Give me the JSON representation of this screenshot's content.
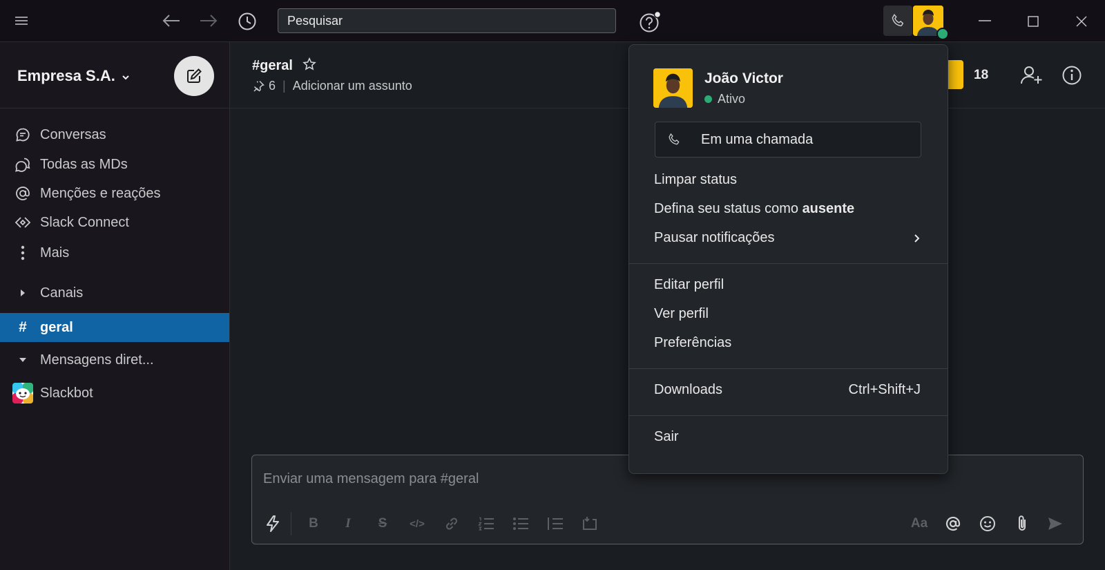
{
  "topbar": {
    "search_placeholder": "Pesquisar"
  },
  "sidebar": {
    "workspace_name": "Empresa S.A.",
    "nav": [
      {
        "label": "Conversas",
        "icon": "threads-icon"
      },
      {
        "label": "Todas as MDs",
        "icon": "dms-icon"
      },
      {
        "label": "Menções e reações",
        "icon": "at-icon"
      },
      {
        "label": "Slack Connect",
        "icon": "slack-connect-icon"
      },
      {
        "label": "Mais",
        "icon": "more-vertical-icon"
      }
    ],
    "channels_section": "Canais",
    "active_channel": "geral",
    "active_channel_prefix": "#",
    "dm_section": "Mensagens diret...",
    "dms": [
      {
        "label": "Slackbot"
      }
    ]
  },
  "channel": {
    "title": "#geral",
    "pins_count": "6",
    "topic_placeholder": "Adicionar um assunto",
    "member_count": "18"
  },
  "composer": {
    "placeholder": "Enviar uma mensagem para #geral",
    "format_label": "Aa"
  },
  "user_menu": {
    "name": "João Victor",
    "presence": "Ativo",
    "call_status": "Em uma chamada",
    "items": {
      "clear_status": "Limpar status",
      "set_away_prefix": "Defina seu status como ",
      "set_away_bold": "ausente",
      "pause_notifications": "Pausar notificações",
      "edit_profile": "Editar perfil",
      "view_profile": "Ver perfil",
      "preferences": "Preferências",
      "downloads": "Downloads",
      "downloads_shortcut": "Ctrl+Shift+J",
      "sign_out": "Sair"
    }
  },
  "colors": {
    "active_channel_bg": "#1164a3",
    "presence_green": "#2bac76",
    "avatar_yellow": "#f9c10a"
  }
}
